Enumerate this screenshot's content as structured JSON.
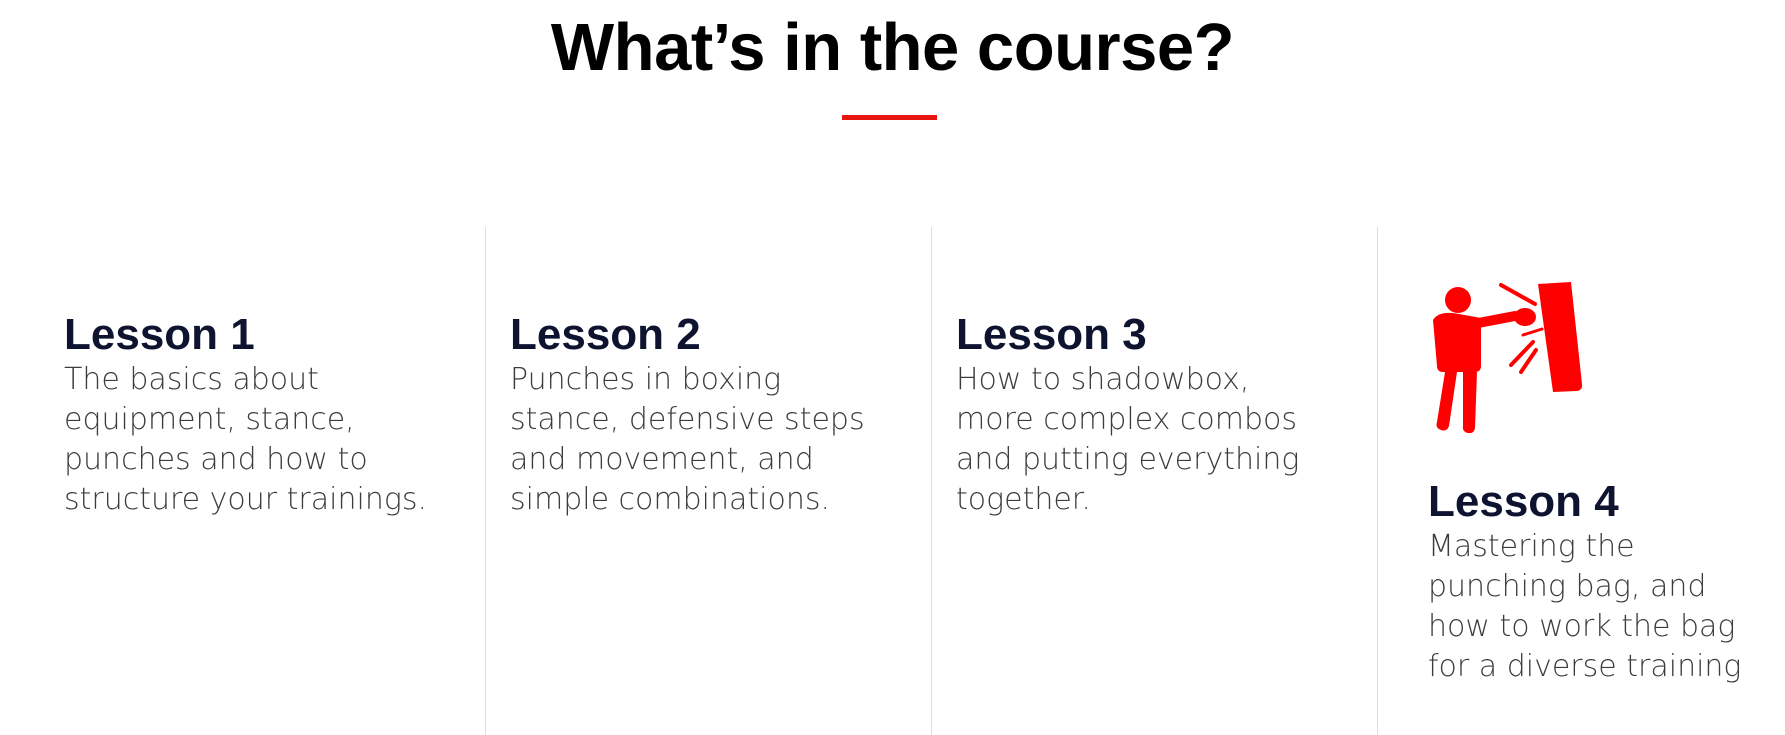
{
  "header": {
    "title": "What’s in the course?",
    "accent_color": "#e8140f"
  },
  "lessons": [
    {
      "title": "Lesson 1",
      "description": "The basics about\nequipment, stance,\npunches and how to\nstructure your trainings."
    },
    {
      "title": "Lesson 2",
      "description": "Punches in boxing\nstance, defensive steps\nand movement, and\nsimple combinations."
    },
    {
      "title": "Lesson 3",
      "description": "How to shadowbox,\nmore complex combos\nand putting everything\ntogether."
    },
    {
      "title": "Lesson 4",
      "description": "Mastering the\npunching bag, and\nhow to work the bag\nfor a diverse training",
      "icon": "boxer-punching-bag-icon"
    }
  ],
  "colors": {
    "heading": "#0e1330",
    "body_text": "#3c3c3c",
    "icon": "#ff0000",
    "divider": "#dddddd"
  }
}
